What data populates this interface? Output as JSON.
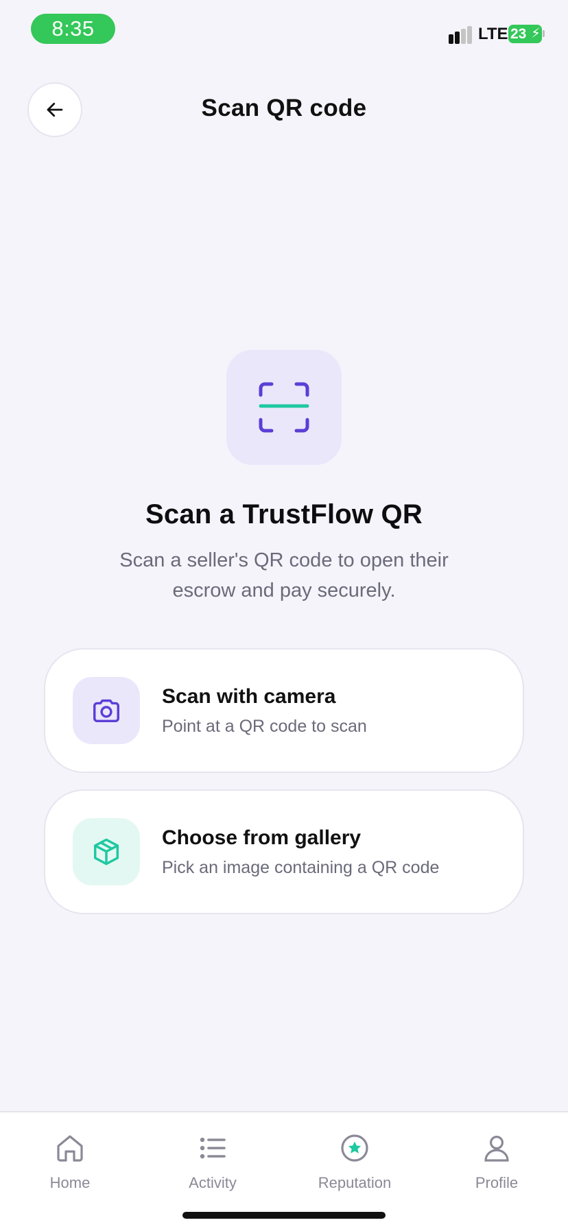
{
  "status_bar": {
    "time": "8:35",
    "network": "LTE",
    "battery": "23"
  },
  "header": {
    "title": "Scan QR code",
    "back_icon": "arrow-left-icon"
  },
  "hero": {
    "icon": "scan-frame-icon",
    "title": "Scan a TrustFlow QR",
    "description": "Scan a seller's QR code to open their escrow and pay securely."
  },
  "options": [
    {
      "icon": "camera-icon",
      "title": "Scan with camera",
      "subtitle": "Point at a QR code to scan"
    },
    {
      "icon": "box-icon",
      "title": "Choose from gallery",
      "subtitle": "Pick an image containing a QR code"
    }
  ],
  "bottom_nav": {
    "items": [
      {
        "icon": "home-icon",
        "label": "Home"
      },
      {
        "icon": "list-icon",
        "label": "Activity"
      },
      {
        "icon": "star-badge-icon",
        "label": "Reputation"
      },
      {
        "icon": "user-icon",
        "label": "Profile"
      }
    ]
  },
  "colors": {
    "background": "#F5F4FA",
    "accent_purple": "#5B3FD6",
    "accent_teal": "#1EC8A0",
    "status_green": "#34C759"
  }
}
